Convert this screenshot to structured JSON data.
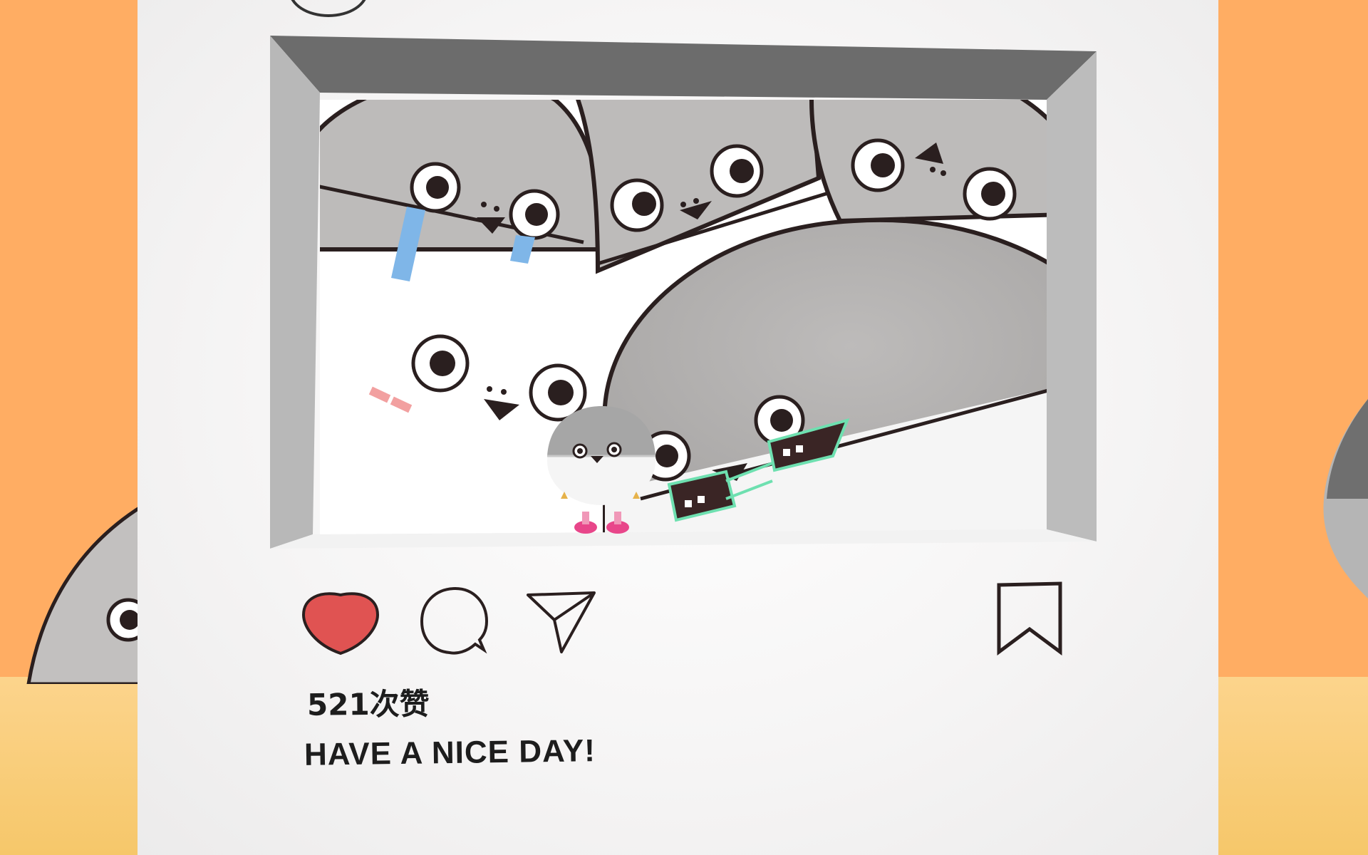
{
  "post": {
    "likes_label": "521次赞",
    "caption": "HAVE A NICE DAY!"
  },
  "colors": {
    "background": "#ffad63",
    "card": "#f4f3f3",
    "like_active": "#e05352",
    "outline": "#2a1f1f"
  },
  "icons": {
    "like": "heart-icon",
    "comment": "speech-bubble-icon",
    "share": "paper-plane-icon",
    "save": "bookmark-icon"
  },
  "state": {
    "liked": true,
    "saved": false
  }
}
